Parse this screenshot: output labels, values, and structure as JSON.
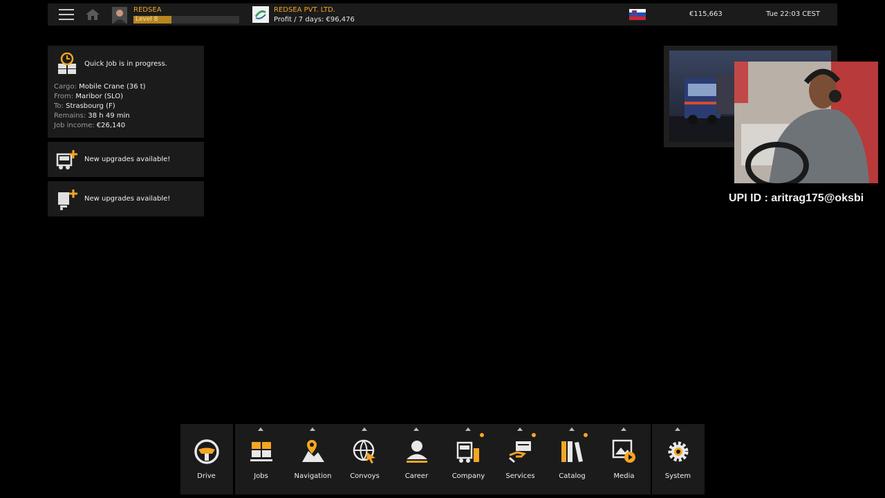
{
  "topbar": {
    "player_name": "REDSEA",
    "level_label": "Level 8",
    "level_progress": 0.36,
    "company_name": "REDSEA PVT. LTD.",
    "profit": "Profit / 7 days: €96,476",
    "money": "€115,663",
    "clock": "Tue 22:03 CEST"
  },
  "job": {
    "title": "Quick Job is in progress.",
    "cargo_label": "Cargo:",
    "cargo": "Mobile Crane (36 t)",
    "from_label": "From:",
    "from": "Maribor (SLO)",
    "to_label": "To:",
    "to": "Strasbourg (F)",
    "remains_label": "Remains:",
    "remains": "38 h 49 min",
    "income_label": "Job income:",
    "income": "€26,140"
  },
  "notifications": [
    {
      "text": "New upgrades available!"
    },
    {
      "text": "New upgrades available!"
    }
  ],
  "overlay": {
    "upi": "UPI ID : aritrag175@oksbi"
  },
  "dock": {
    "drive": "Drive",
    "items": [
      {
        "label": "Jobs"
      },
      {
        "label": "Navigation"
      },
      {
        "label": "Convoys"
      },
      {
        "label": "Career"
      },
      {
        "label": "Company"
      },
      {
        "label": "Services"
      },
      {
        "label": "Catalog"
      },
      {
        "label": "Media"
      }
    ],
    "system": "System"
  },
  "colors": {
    "accent": "#f5a623",
    "panel": "#1b1b1b",
    "background": "#000000"
  }
}
